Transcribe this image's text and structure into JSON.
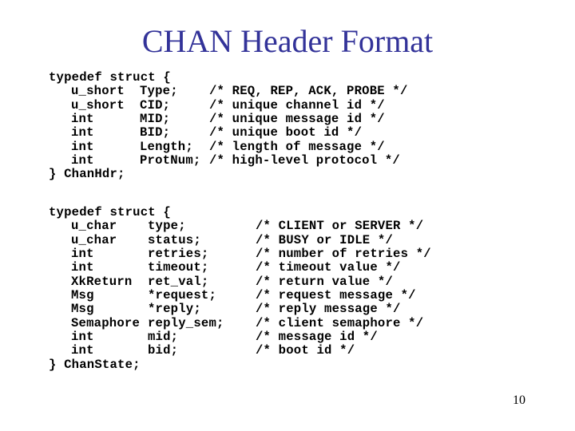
{
  "slide": {
    "title": "CHAN Header Format",
    "page_number": "10"
  },
  "chan_hdr": {
    "open": "typedef struct {",
    "fields": [
      {
        "type": "u_short",
        "name": "Type;",
        "comment": "/* REQ, REP, ACK, PROBE */"
      },
      {
        "type": "u_short",
        "name": "CID;",
        "comment": "/* unique channel id */"
      },
      {
        "type": "int",
        "name": "MID;",
        "comment": "/* unique message id */"
      },
      {
        "type": "int",
        "name": "BID;",
        "comment": "/* unique boot id */"
      },
      {
        "type": "int",
        "name": "Length;",
        "comment": "/* length of message */"
      },
      {
        "type": "int",
        "name": "ProtNum;",
        "comment": "/* high-level protocol */"
      }
    ],
    "close": "} ChanHdr;"
  },
  "chan_state": {
    "open": "typedef struct {",
    "fields": [
      {
        "type": "u_char",
        "name": "type;",
        "comment": "/* CLIENT or SERVER */"
      },
      {
        "type": "u_char",
        "name": "status;",
        "comment": "/* BUSY or IDLE */"
      },
      {
        "type": "int",
        "name": "retries;",
        "comment": "/* number of retries */"
      },
      {
        "type": "int",
        "name": "timeout;",
        "comment": "/* timeout value */"
      },
      {
        "type": "XkReturn",
        "name": "ret_val;",
        "comment": "/* return value */"
      },
      {
        "type": "Msg",
        "name": "*request;",
        "comment": "/* request message */"
      },
      {
        "type": "Msg",
        "name": "*reply;",
        "comment": "/* reply message */"
      },
      {
        "type": "Semaphore",
        "name": "reply_sem;",
        "comment": "/* client semaphore */"
      },
      {
        "type": "int",
        "name": "mid;",
        "comment": "/* message id */"
      },
      {
        "type": "int",
        "name": "bid;",
        "comment": "/* boot id */"
      }
    ],
    "close": "} ChanState;"
  }
}
